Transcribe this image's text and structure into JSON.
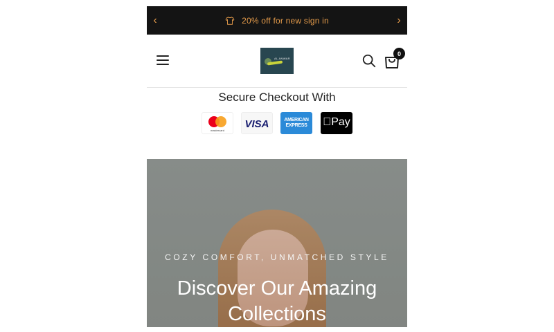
{
  "announcement": {
    "message": "20% off for new sign in",
    "icon": "tshirt-icon",
    "prev_icon": "chevron-left-icon",
    "next_icon": "chevron-right-icon",
    "text_color": "#e39a4a",
    "background": "#141414"
  },
  "header": {
    "menu_icon": "hamburger-icon",
    "logo_text": "AL ANWAR",
    "search_icon": "search-icon",
    "cart_icon": "shopping-bag-icon",
    "cart_count": "0"
  },
  "checkout": {
    "title": "Secure Checkout With",
    "methods": [
      {
        "name": "mastercard",
        "label": "mastercard"
      },
      {
        "name": "visa",
        "label": "VISA"
      },
      {
        "name": "amex",
        "label": "AMERICAN EXPRESS"
      },
      {
        "name": "apple-pay",
        "label": "Pay"
      }
    ]
  },
  "hero": {
    "subtitle": "COZY COMFORT, UNMATCHED STYLE",
    "title": "Discover Our Amazing Collections"
  }
}
